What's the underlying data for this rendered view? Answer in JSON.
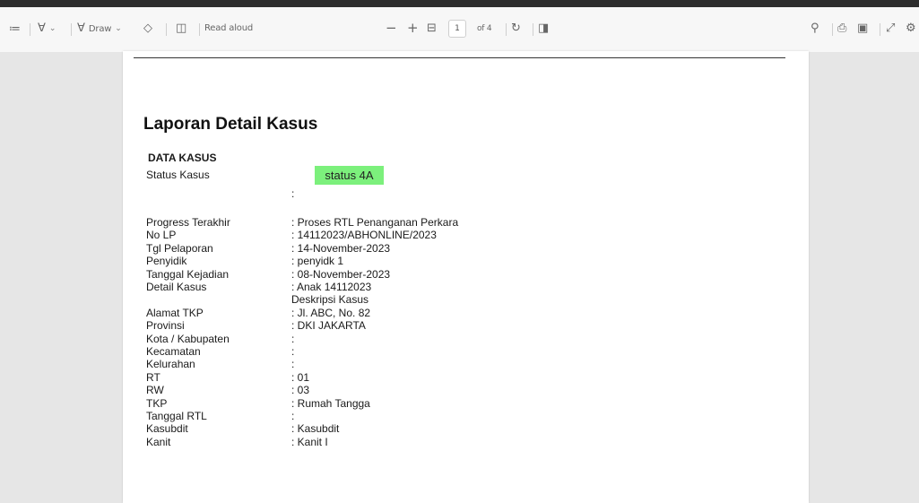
{
  "toolbar": {
    "draw_label": "Draw",
    "read_aloud_label": "Read aloud",
    "page_current": "1",
    "page_total": "of 4"
  },
  "document": {
    "title": "Laporan Detail Kasus",
    "section": "DATA KASUS",
    "status_label": "Status Kasus",
    "status_value": "status 4A",
    "status_colon": ":",
    "status_color": "#7cf07c",
    "fields": [
      {
        "label": "Progress Terakhir",
        "value": ": Proses RTL Penanganan Perkara"
      },
      {
        "label": "No LP",
        "value": ": 14112023/ABHONLINE/2023"
      },
      {
        "label": "Tgl Pelaporan",
        "value": ": 14-November-2023"
      },
      {
        "label": "Penyidik",
        "value": ": penyidk 1"
      },
      {
        "label": "Tanggal Kejadian",
        "value": ": 08-November-2023"
      },
      {
        "label": "Detail Kasus",
        "value": ": Anak 14112023"
      },
      {
        "label": "",
        "value": "  Deskripsi Kasus"
      },
      {
        "label": "Alamat TKP",
        "value": ": Jl. ABC, No. 82"
      },
      {
        "label": "Provinsi",
        "value": ": DKI JAKARTA"
      },
      {
        "label": "Kota / Kabupaten",
        "value": ":"
      },
      {
        "label": "Kecamatan",
        "value": ":"
      },
      {
        "label": "Kelurahan",
        "value": ":"
      },
      {
        "label": "RT",
        "value": ": 01"
      },
      {
        "label": "RW",
        "value": ": 03"
      },
      {
        "label": "TKP",
        "value": ": Rumah Tangga"
      },
      {
        "label": "Tanggal RTL",
        "value": ":"
      },
      {
        "label": "Kasubdit",
        "value": ": Kasubdit"
      },
      {
        "label": "Kanit",
        "value": ": Kanit I"
      }
    ]
  }
}
